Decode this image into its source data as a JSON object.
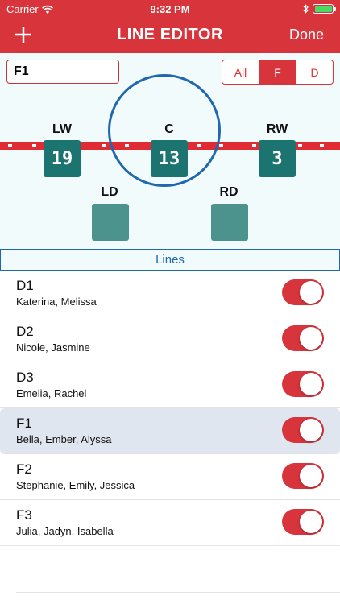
{
  "status": {
    "carrier": "Carrier",
    "time": "9:32 PM",
    "battery_color": "#4cd964"
  },
  "nav": {
    "title": "LINE EDITOR",
    "add_icon": "plus-icon",
    "done_label": "Done"
  },
  "editor": {
    "line_name_value": "F1",
    "filter_options": [
      "All",
      "F",
      "D"
    ],
    "filter_selected": "F",
    "positions": {
      "lw": {
        "label": "LW",
        "number": "19"
      },
      "c": {
        "label": "C",
        "number": "13"
      },
      "rw": {
        "label": "RW",
        "number": "3"
      },
      "ld": {
        "label": "LD",
        "number": ""
      },
      "rd": {
        "label": "RD",
        "number": ""
      }
    }
  },
  "lines_header": "Lines",
  "lines": [
    {
      "name": "D1",
      "players": "Katerina, Melissa",
      "enabled": true,
      "selected": false
    },
    {
      "name": "D2",
      "players": "Nicole, Jasmine",
      "enabled": true,
      "selected": false
    },
    {
      "name": "D3",
      "players": "Emelia, Rachel",
      "enabled": true,
      "selected": false
    },
    {
      "name": "F1",
      "players": "Bella, Ember, Alyssa",
      "enabled": true,
      "selected": true
    },
    {
      "name": "F2",
      "players": "Stephanie, Emily, Jessica",
      "enabled": true,
      "selected": false
    },
    {
      "name": "F3",
      "players": "Julia, Jadyn, Isabella",
      "enabled": true,
      "selected": false
    }
  ],
  "colors": {
    "accent": "#d8343c",
    "jersey": "#1c7470",
    "empty_slot": "#4d938d",
    "circle": "#1f68b0"
  }
}
